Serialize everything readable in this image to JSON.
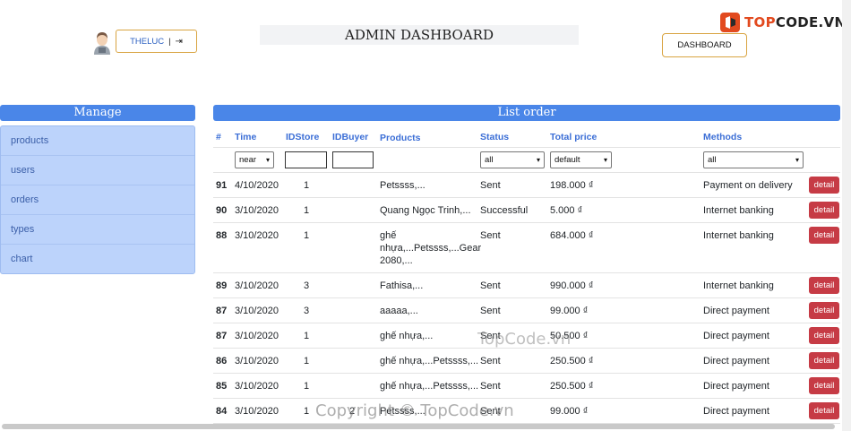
{
  "header": {
    "user_label": "THELUC",
    "separator": "|",
    "title": "ADMIN DASHBOARD",
    "dashboard_button": "DASHBOARD",
    "logo_prefix": "TOP",
    "logo_suffix": "CODE.VN"
  },
  "sidebar": {
    "title": "Manage",
    "items": [
      {
        "label": "products"
      },
      {
        "label": "users"
      },
      {
        "label": "orders"
      },
      {
        "label": "types"
      },
      {
        "label": "chart"
      }
    ]
  },
  "orders": {
    "title": "List order",
    "columns": {
      "no": "#",
      "time": "Time",
      "store": "IDStore",
      "buyer": "IDBuyer",
      "products": "Products",
      "status": "Status",
      "total": "Total price",
      "methods": "Methods"
    },
    "filters": {
      "time": "near",
      "status": "all",
      "total": "default",
      "methods": "all"
    },
    "detail_label": "detail",
    "rows": [
      {
        "no": "91",
        "time": "4/10/2020",
        "store": "1",
        "buyer": "",
        "products": "Petssss,...",
        "status": "Sent",
        "total": "198.000 ₫",
        "method": "Payment on delivery"
      },
      {
        "no": "90",
        "time": "3/10/2020",
        "store": "1",
        "buyer": "",
        "products": "Quang Ngọc Trinh,...",
        "status": "Successful",
        "total": "5.000 ₫",
        "method": "Internet banking"
      },
      {
        "no": "88",
        "time": "3/10/2020",
        "store": "1",
        "buyer": "",
        "products": "ghế nhựa,...Petssss,...Gear 2080,...",
        "status": "Sent",
        "total": "684.000 ₫",
        "method": "Internet banking"
      },
      {
        "no": "89",
        "time": "3/10/2020",
        "store": "3",
        "buyer": "",
        "products": "Fathisa,...",
        "status": "Sent",
        "total": "990.000 ₫",
        "method": "Internet banking"
      },
      {
        "no": "87",
        "time": "3/10/2020",
        "store": "3",
        "buyer": "",
        "products": "aaaaa,...",
        "status": "Sent",
        "total": "99.000 ₫",
        "method": "Direct payment"
      },
      {
        "no": "87",
        "time": "3/10/2020",
        "store": "1",
        "buyer": "",
        "products": "ghế nhựa,...",
        "status": "Sent",
        "total": "50.500 ₫",
        "method": "Direct payment"
      },
      {
        "no": "86",
        "time": "3/10/2020",
        "store": "1",
        "buyer": "",
        "products": "ghế nhựa,...Petssss,...",
        "status": "Sent",
        "total": "250.500 ₫",
        "method": "Direct payment"
      },
      {
        "no": "85",
        "time": "3/10/2020",
        "store": "1",
        "buyer": "",
        "products": "ghế nhựa,...Petssss,...",
        "status": "Sent",
        "total": "250.500 ₫",
        "method": "Direct payment"
      },
      {
        "no": "84",
        "time": "3/10/2020",
        "store": "1",
        "buyer": "2",
        "products": "Petssss,...",
        "status": "Sent",
        "total": "99.000 ₫",
        "method": "Direct payment"
      }
    ]
  },
  "watermarks": {
    "center": "TopCode.vn",
    "bottom": "Copyright © TopCode.vn"
  },
  "colors": {
    "primary": "#4a86e8",
    "sidebar_bg": "#bcd3fb",
    "danger": "#c63b45",
    "border_gold": "#d9a441"
  }
}
